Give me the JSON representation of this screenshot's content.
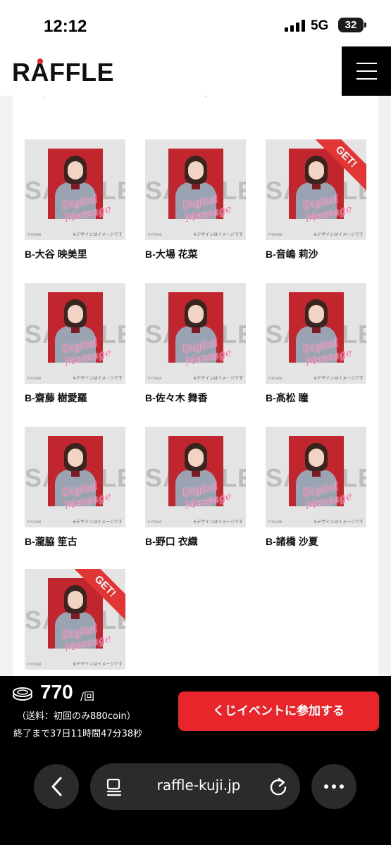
{
  "status_bar": {
    "time": "12:12",
    "network": "5G",
    "battery": "32"
  },
  "header": {
    "logo_text": "RAFFLE",
    "menu": "menu"
  },
  "grid": {
    "sample_watermark": "SAMPLE",
    "message_watermark": "Digital Message",
    "copyright": "©YDANI",
    "image_note": "※デザインはイメージです",
    "get_badge": "GET!",
    "items": [
      {
        "name": "B-大谷 映美里",
        "get": false
      },
      {
        "name": "B-大場 花菜",
        "get": false
      },
      {
        "name": "B-音嶋 莉沙",
        "get": true
      },
      {
        "name": "B-齋藤 樹愛羅",
        "get": false
      },
      {
        "name": "B-佐々木 舞香",
        "get": false
      },
      {
        "name": "B-髙松 瞳",
        "get": false
      },
      {
        "name": "B-瀧脇 笙古",
        "get": false
      },
      {
        "name": "B-野口 衣織",
        "get": false
      },
      {
        "name": "B-諸橋 沙夏",
        "get": false
      },
      {
        "name": "",
        "get": true
      }
    ]
  },
  "purchase": {
    "price": "770",
    "unit": "/回",
    "fee_note": "（送料：初回のみ880coin）",
    "time_left": "終了まで37日11時間47分38秒",
    "cta_label": "くじイベントに参加する"
  },
  "browser": {
    "url": "raffle-kuji.jp",
    "back": "back",
    "reader": "reader",
    "reload": "reload",
    "more": "more"
  },
  "colors": {
    "accent": "#e8252a",
    "get_badge": "#e23636",
    "message_pink": "#f16aa6"
  }
}
